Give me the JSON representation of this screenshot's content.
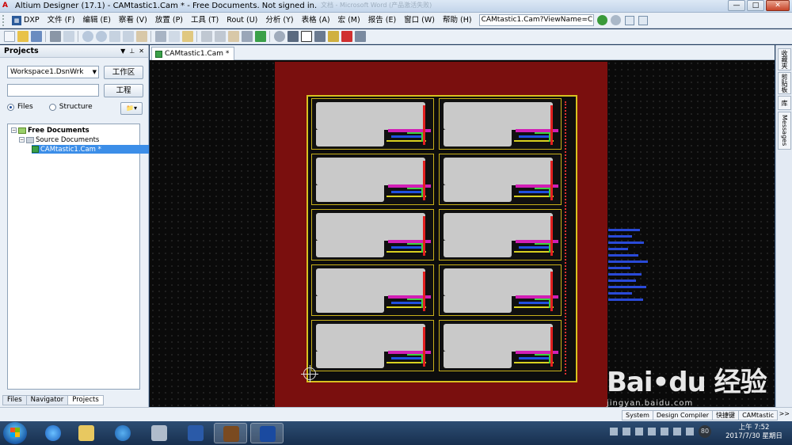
{
  "window": {
    "title": "Altium Designer (17.1) - CAMtastic1.Cam * - Free Documents. Not signed in.",
    "background_task": "文档 - Microsoft Word (产品激活失败)",
    "controls": [
      "—",
      "□",
      "✕"
    ]
  },
  "menubar": {
    "items": [
      "DXP",
      "文件 (F)",
      "编辑 (E)",
      "察看 (V)",
      "放置 (P)",
      "工具 (T)",
      "Rout (U)",
      "分析 (Y)",
      "表格 (A)",
      "宏 (M)",
      "报告 (E)",
      "窗口 (W)",
      "帮助 (H)"
    ],
    "path_value": "CAMtastic1.Cam?ViewName=C"
  },
  "projects_panel": {
    "title": "Projects",
    "workspace_value": "Workspace1.DsnWrk",
    "workspace_button": "工作区",
    "project_button": "工程",
    "radio_files": "Files",
    "radio_structure": "Structure",
    "tree": {
      "root": "Free Documents",
      "folder": "Source Documents",
      "file": "CAMtastic1.Cam *"
    },
    "bottom_tabs": [
      "Files",
      "Navigator",
      "Projects"
    ]
  },
  "document": {
    "tab_label": "CAMtastic1.Cam *"
  },
  "right_dock": {
    "tabs": [
      "收藏夹",
      "剪贴板",
      "库",
      "Messages"
    ]
  },
  "statusbar": {
    "tabs": [
      "System",
      "Design Compiler",
      "快捷键",
      "CAMtastic"
    ],
    "more": ">>"
  },
  "taskbar": {
    "clock_time": "上午 7:52",
    "clock_date": "2017/7/30 星期日",
    "tray_badge": "80"
  },
  "watermark": {
    "brand": "Bai•du 经验",
    "url": "jingyan.baidu.com"
  },
  "colors": {
    "board": "#7a0f0e",
    "canvas": "#0a0a0a",
    "shield": "#c9c9c9",
    "accent": "#3c8ee8"
  }
}
